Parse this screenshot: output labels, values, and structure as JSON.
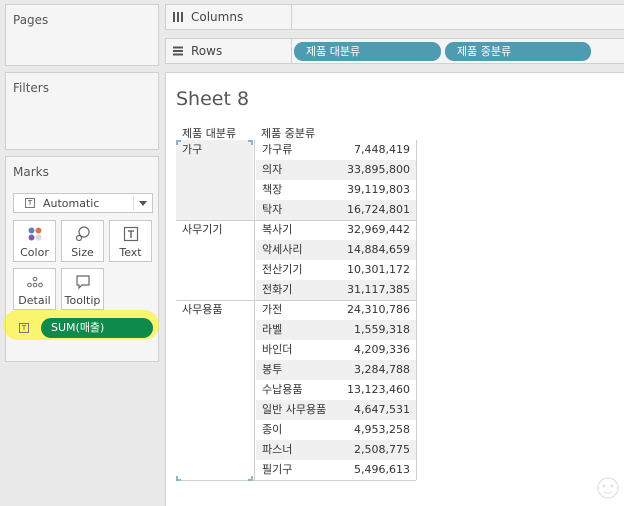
{
  "panels": {
    "pages_title": "Pages",
    "filters_title": "Filters",
    "marks_title": "Marks"
  },
  "marks": {
    "mark_type": "Automatic",
    "cards": [
      {
        "label": "Color",
        "icon": "color-dots-icon"
      },
      {
        "label": "Size",
        "icon": "size-icon"
      },
      {
        "label": "Text",
        "icon": "text-icon"
      },
      {
        "label": "Detail",
        "icon": "detail-dots-icon"
      },
      {
        "label": "Tooltip",
        "icon": "tooltip-icon"
      }
    ],
    "text_pill": "SUM(매출)",
    "pill_color": "#0e8a4a",
    "highlight_color": "#fff200"
  },
  "shelves": {
    "columns_label": "Columns",
    "rows_label": "Rows",
    "row_pills": [
      "제품 대분류",
      "제품 중분류"
    ],
    "pill_color": "#4f9bb2"
  },
  "sheet": {
    "title": "Sheet 8",
    "headers": [
      "제품 대분류",
      "제품 중분류"
    ],
    "groups": [
      {
        "category": "가구",
        "rows": [
          {
            "sub": "가구류",
            "value": "7,448,419"
          },
          {
            "sub": "의자",
            "value": "33,895,800"
          },
          {
            "sub": "책장",
            "value": "39,119,803"
          },
          {
            "sub": "탁자",
            "value": "16,724,801"
          }
        ]
      },
      {
        "category": "사무기기",
        "rows": [
          {
            "sub": "복사기",
            "value": "32,969,442"
          },
          {
            "sub": "악세사리",
            "value": "14,884,659"
          },
          {
            "sub": "전산기기",
            "value": "10,301,172"
          },
          {
            "sub": "전화기",
            "value": "31,117,385"
          }
        ]
      },
      {
        "category": "사무용품",
        "rows": [
          {
            "sub": "가전",
            "value": "24,310,786"
          },
          {
            "sub": "라벨",
            "value": "1,559,318"
          },
          {
            "sub": "바인더",
            "value": "4,209,336"
          },
          {
            "sub": "봉투",
            "value": "3,284,788"
          },
          {
            "sub": "수납용품",
            "value": "13,123,460"
          },
          {
            "sub": "일반 사무용품",
            "value": "4,647,531"
          },
          {
            "sub": "종이",
            "value": "4,953,258"
          },
          {
            "sub": "파스너",
            "value": "2,508,775"
          },
          {
            "sub": "필기구",
            "value": "5,496,613"
          }
        ]
      }
    ]
  }
}
